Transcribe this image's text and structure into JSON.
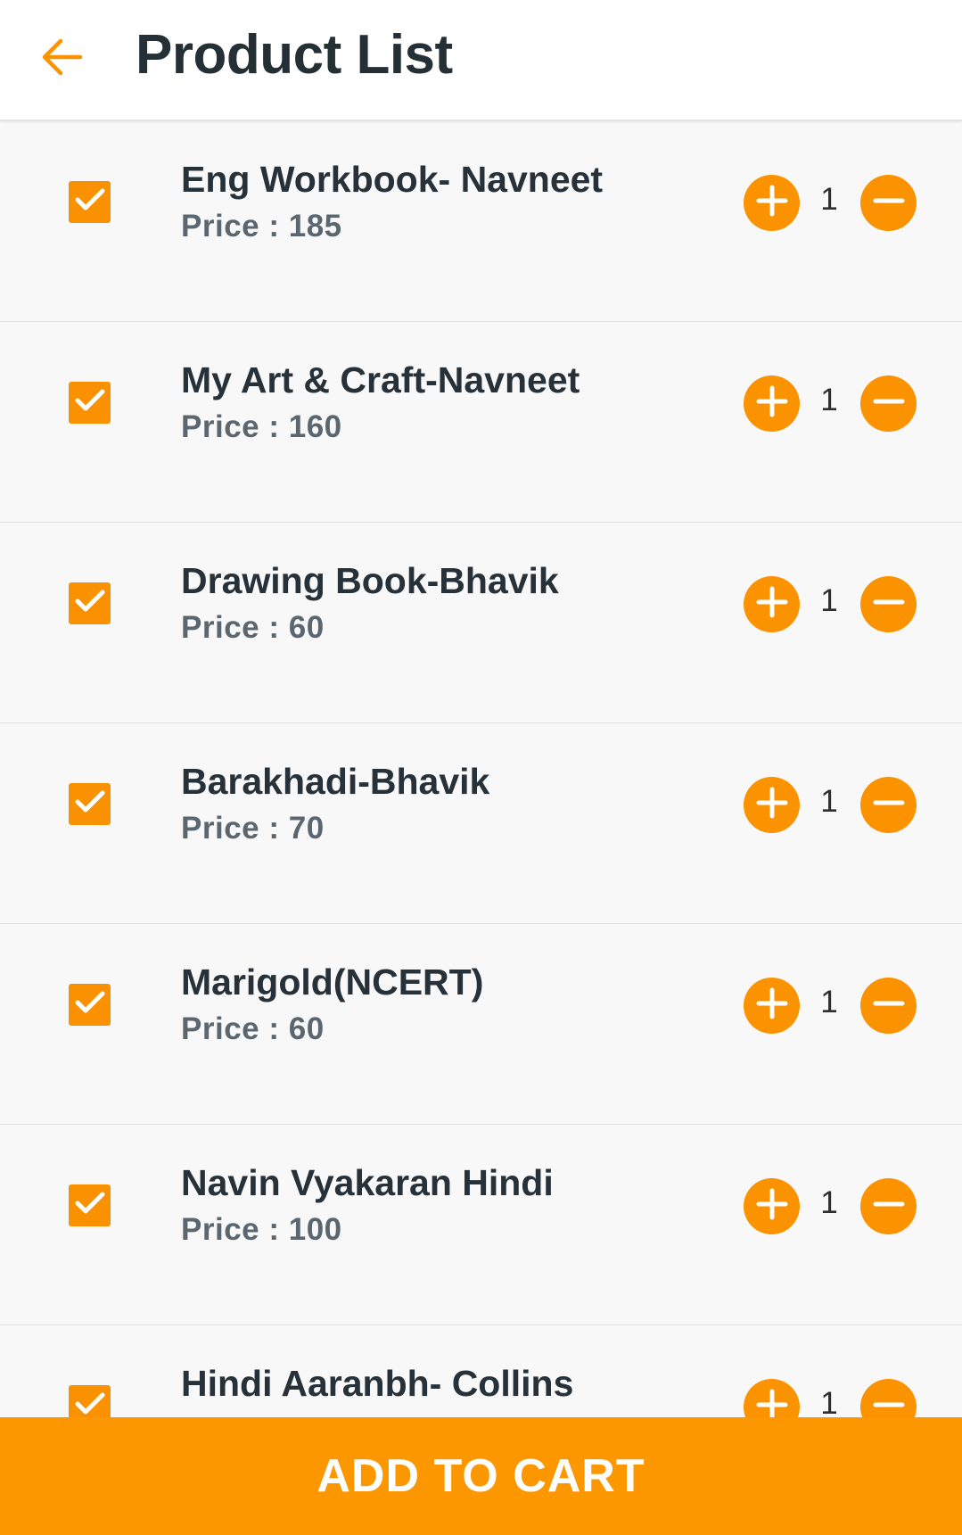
{
  "header": {
    "title": "Product List"
  },
  "colors": {
    "accent": "#fb9300",
    "title_text": "#253036",
    "price_text": "#5b6770"
  },
  "products": [
    {
      "name": "Eng Workbook- Navneet",
      "price": "Price : 185",
      "qty": "1",
      "checked": true
    },
    {
      "name": "My Art & Craft-Navneet",
      "price": "Price : 160",
      "qty": "1",
      "checked": true
    },
    {
      "name": "Drawing Book-Bhavik",
      "price": "Price : 60",
      "qty": "1",
      "checked": true
    },
    {
      "name": "Barakhadi-Bhavik",
      "price": "Price : 70",
      "qty": "1",
      "checked": true
    },
    {
      "name": "Marigold(NCERT)",
      "price": "Price : 60",
      "qty": "1",
      "checked": true
    },
    {
      "name": "Navin Vyakaran Hindi",
      "price": "Price : 100",
      "qty": "1",
      "checked": true
    },
    {
      "name": "Hindi Aaranbh- Collins",
      "price": "",
      "qty": "1",
      "checked": true
    }
  ],
  "footer": {
    "cart_label": "ADD TO CART"
  }
}
